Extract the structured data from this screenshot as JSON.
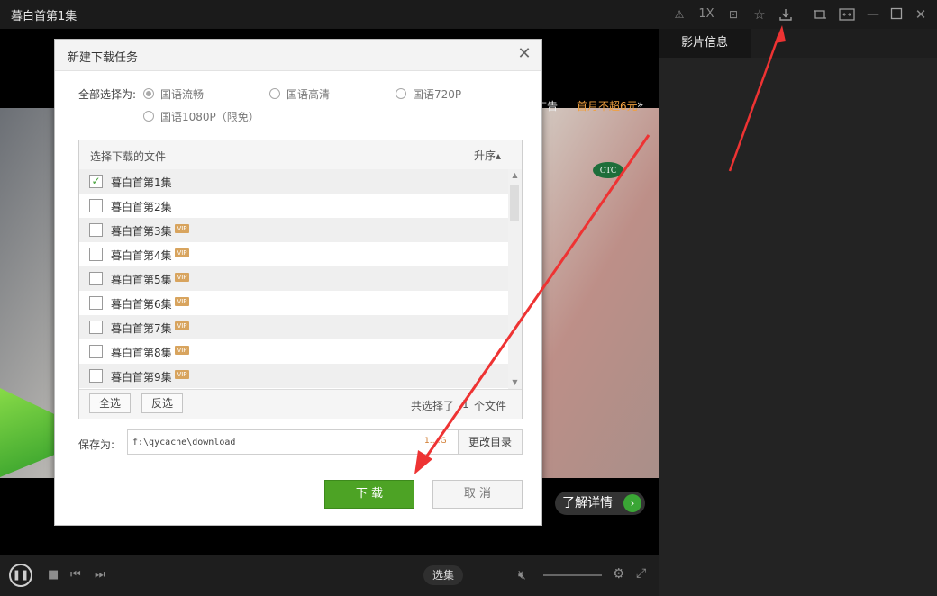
{
  "window": {
    "title": "暮白首第1集",
    "speed": "1X"
  },
  "side_panel": {
    "tab": "影片信息"
  },
  "video": {
    "ad_skip": "跳过广告",
    "ad_offer": "首月不超6元",
    "ad_offer_arrow": "»",
    "otc": "OTC",
    "detail_button": "了解详情",
    "detail_go": "›"
  },
  "controls": {
    "select_episode": "选集"
  },
  "dialog": {
    "title": "新建下载任务",
    "close": "✕",
    "select_all_label": "全部选择为:",
    "quality_options": [
      {
        "label": "国语流畅",
        "selected": true
      },
      {
        "label": "国语高清",
        "selected": false
      },
      {
        "label": "国语720P",
        "selected": false
      },
      {
        "label": "国语1080P（限免）",
        "selected": false
      }
    ],
    "file_list": {
      "header": "选择下载的文件",
      "sort": "升序▴",
      "items": [
        {
          "name": "暮白首第1集",
          "checked": true,
          "vip": false
        },
        {
          "name": "暮白首第2集",
          "checked": false,
          "vip": false
        },
        {
          "name": "暮白首第3集",
          "checked": false,
          "vip": true
        },
        {
          "name": "暮白首第4集",
          "checked": false,
          "vip": true
        },
        {
          "name": "暮白首第5集",
          "checked": false,
          "vip": true
        },
        {
          "name": "暮白首第6集",
          "checked": false,
          "vip": true
        },
        {
          "name": "暮白首第7集",
          "checked": false,
          "vip": true
        },
        {
          "name": "暮白首第8集",
          "checked": false,
          "vip": true
        },
        {
          "name": "暮白首第9集",
          "checked": false,
          "vip": true
        }
      ],
      "vip_badge": "VIP",
      "check_mark": "✓",
      "select_all_button": "全选",
      "invert_button": "反选",
      "selected_prefix": "共选择了",
      "selected_count": "1",
      "selected_suffix": "个文件"
    },
    "save_as_label": "保存为:",
    "save_path": "f:\\qycache\\download",
    "size": "1.…G",
    "change_dir_button": "更改目录",
    "download_button": "下 载",
    "cancel_button": "取 消"
  },
  "colors": {
    "accent_green": "#4da325",
    "offer_orange": "#f0a040",
    "arrow_red": "#ee3333"
  }
}
